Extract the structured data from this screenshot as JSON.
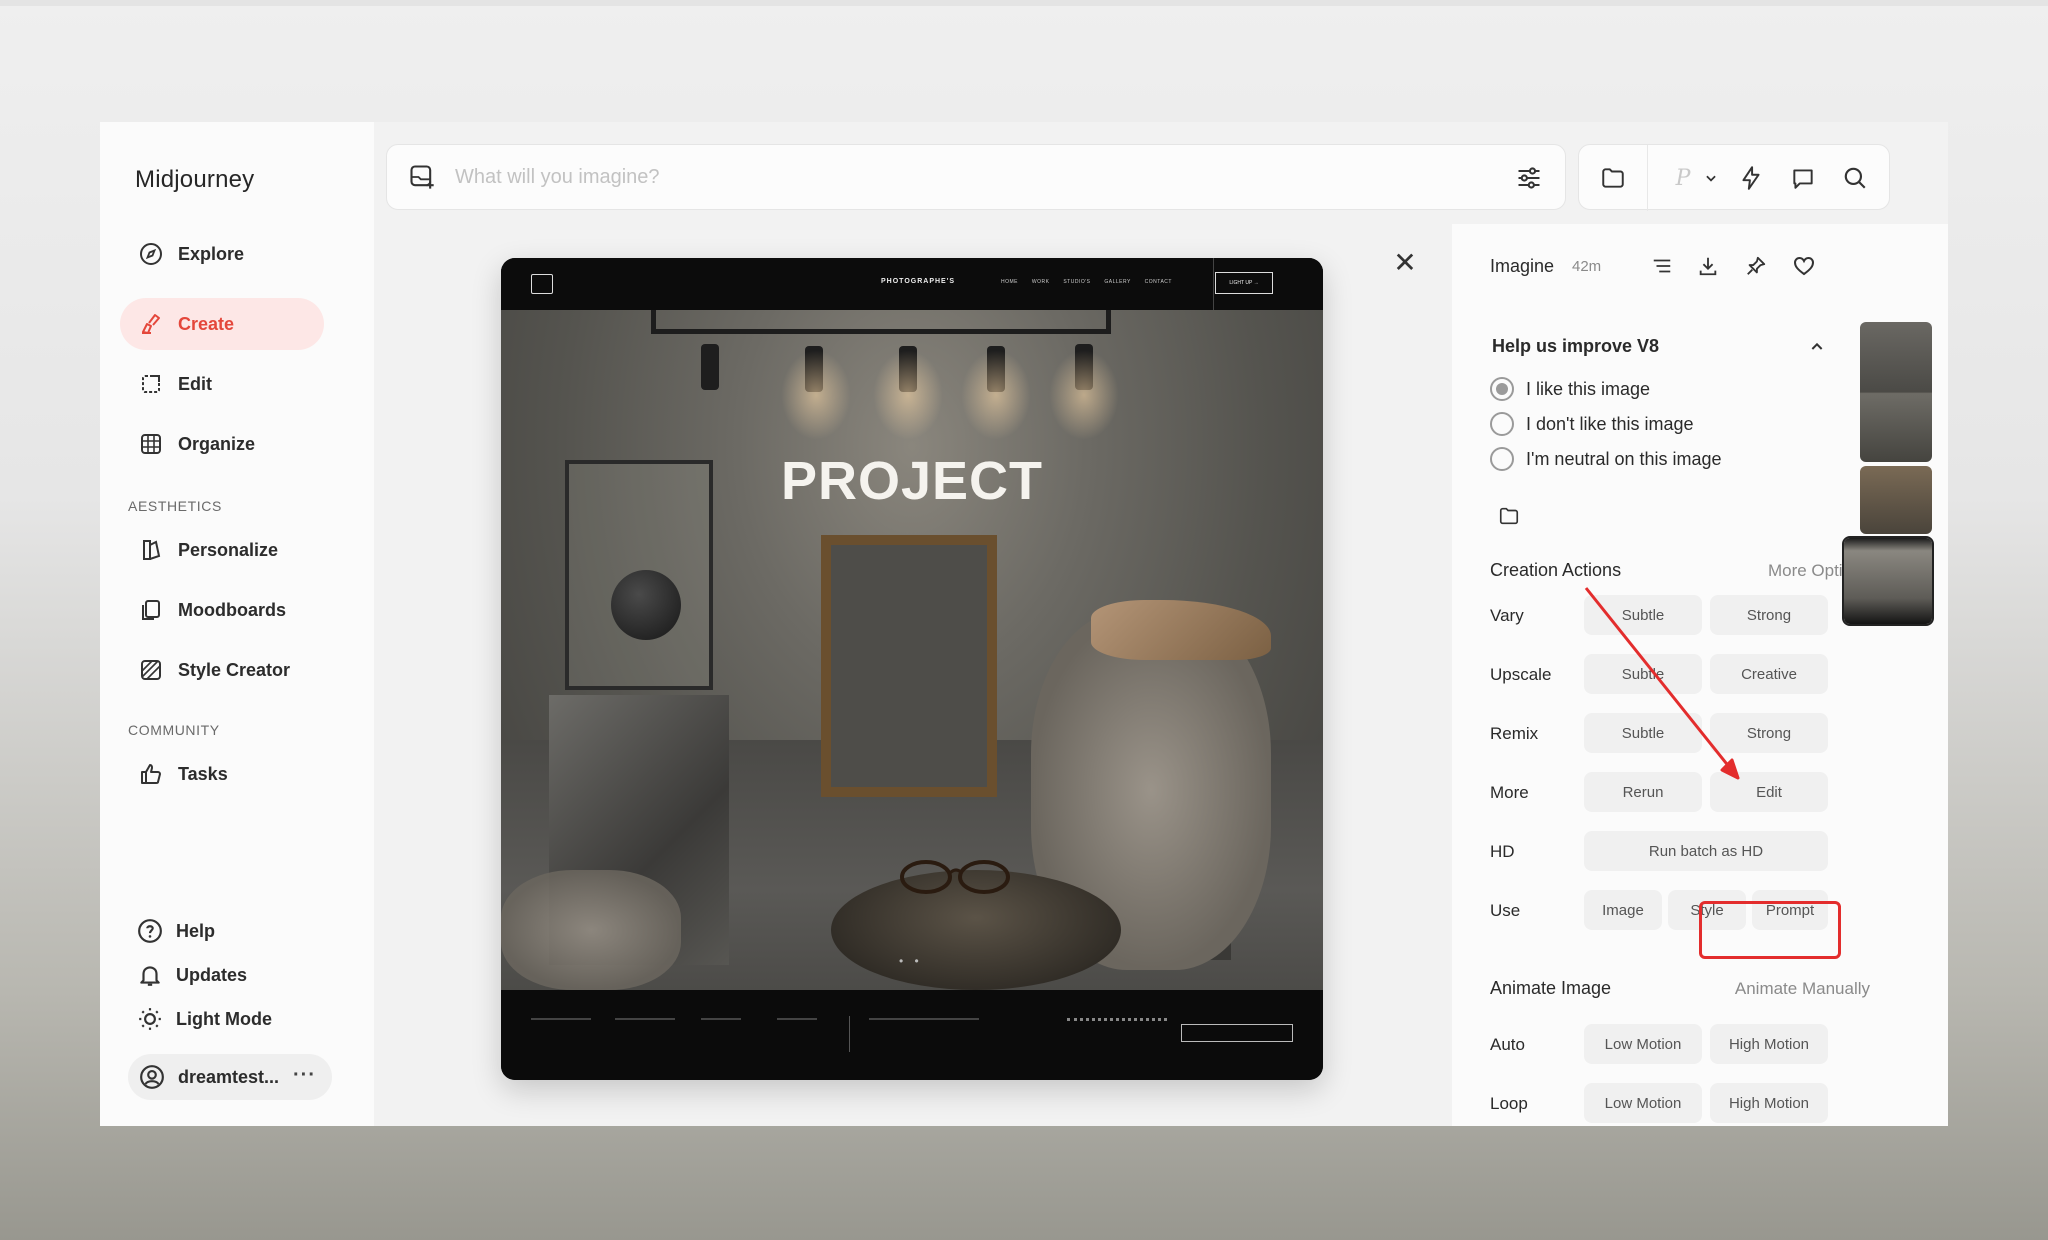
{
  "app": {
    "title": "Midjourney"
  },
  "sidebar": {
    "items": [
      {
        "label": "Explore",
        "icon": "compass-icon"
      },
      {
        "label": "Create",
        "icon": "brush-icon",
        "active": true
      },
      {
        "label": "Edit",
        "icon": "edit-frame-icon"
      },
      {
        "label": "Organize",
        "icon": "grid-icon"
      }
    ],
    "aesthetics_label": "AESTHETICS",
    "aesthetics": [
      {
        "label": "Personalize",
        "icon": "personalize-icon"
      },
      {
        "label": "Moodboards",
        "icon": "moodboards-icon"
      },
      {
        "label": "Style Creator",
        "icon": "style-creator-icon"
      }
    ],
    "community_label": "COMMUNITY",
    "community": [
      {
        "label": "Tasks",
        "icon": "thumbs-up-icon"
      }
    ],
    "bottom": [
      {
        "label": "Help",
        "icon": "help-icon"
      },
      {
        "label": "Updates",
        "icon": "bell-icon"
      },
      {
        "label": "Light Mode",
        "icon": "sun-icon"
      }
    ],
    "user": {
      "name": "dreamtest...",
      "more": "···"
    }
  },
  "prompt": {
    "placeholder": "What will you imagine?",
    "value": ""
  },
  "toolbar": {
    "p_label": "P"
  },
  "image": {
    "headline": "PROJECT",
    "site_brand": "PHOTOGRAPHE'S",
    "site_links": "HOME WORK STUDIO'S GALLERY CONTACT",
    "site_cta": "LIGHT UP →",
    "dots": "• •"
  },
  "panel": {
    "title": "Imagine",
    "time": "42m",
    "feedback": {
      "title": "Help us improve V8",
      "options": [
        {
          "label": "I like this image",
          "checked": true
        },
        {
          "label": "I don't like this image",
          "checked": false
        },
        {
          "label": "I'm neutral on this image",
          "checked": false
        }
      ]
    },
    "creation_actions": {
      "title": "Creation Actions",
      "more": "More Options",
      "rows": [
        {
          "label": "Vary",
          "buttons": [
            "Subtle",
            "Strong"
          ]
        },
        {
          "label": "Upscale",
          "buttons": [
            "Subtle",
            "Creative"
          ]
        },
        {
          "label": "Remix",
          "buttons": [
            "Subtle",
            "Strong"
          ]
        },
        {
          "label": "More",
          "buttons": [
            "Rerun",
            "Edit"
          ]
        },
        {
          "label": "HD",
          "buttons": [
            "Run batch as HD"
          ]
        },
        {
          "label": "Use",
          "buttons": [
            "Image",
            "Style",
            "Prompt"
          ]
        }
      ]
    },
    "animate": {
      "title": "Animate Image",
      "more": "Animate Manually",
      "rows": [
        {
          "label": "Auto",
          "buttons": [
            "Low Motion",
            "High Motion"
          ]
        },
        {
          "label": "Loop",
          "buttons": [
            "Low Motion",
            "High Motion"
          ]
        }
      ]
    }
  },
  "colors": {
    "accent": "#e4473b",
    "active_bg": "#fde7e6",
    "annotation": "#e32d2d"
  }
}
